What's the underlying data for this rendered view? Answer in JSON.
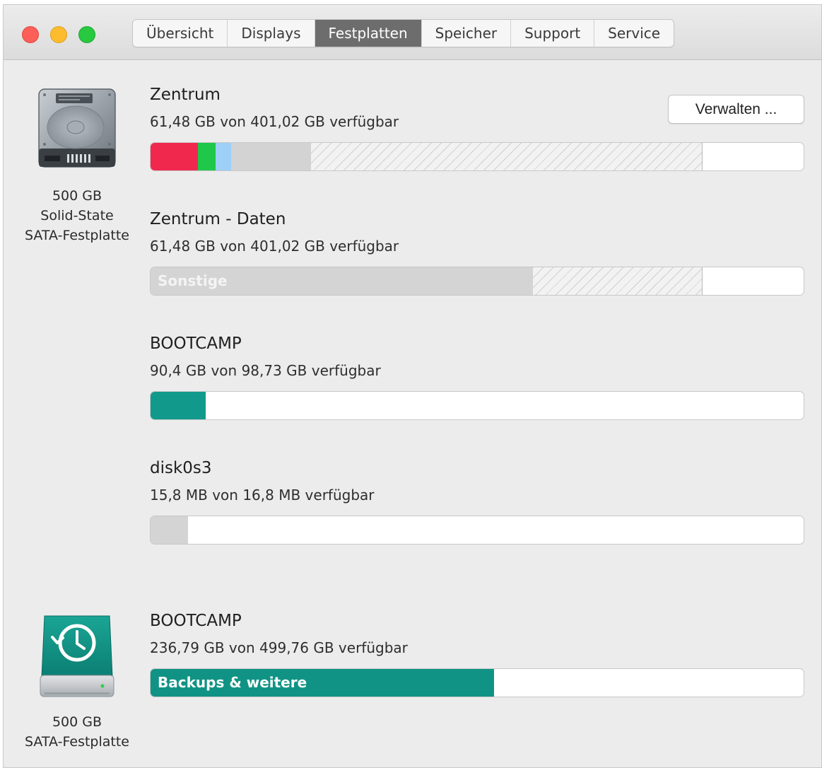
{
  "toolbar": {
    "tabs": [
      {
        "label": "Übersicht"
      },
      {
        "label": "Displays"
      },
      {
        "label": "Festplatten"
      },
      {
        "label": "Speicher"
      },
      {
        "label": "Support"
      },
      {
        "label": "Service"
      }
    ],
    "active_tab": "Festplatten"
  },
  "disks": [
    {
      "icon": "hard-drive-icon",
      "caption": [
        "500 GB",
        "Solid-State",
        "SATA-Festplatte"
      ],
      "volumes": [
        {
          "name": "Zentrum",
          "available": "61,48 GB von 401,02 GB verfügbar",
          "manage_button": "Verwalten ...",
          "usage_segments": [
            {
              "color": "#f0284e",
              "fraction": 0.073
            },
            {
              "color": "#1fc84a",
              "fraction": 0.027
            },
            {
              "color": "#9ecff6",
              "fraction": 0.024
            },
            {
              "color": "#d3d3d3",
              "fraction": 0.122
            }
          ],
          "purgeable_fraction": 0.6
        },
        {
          "name": "Zentrum - Daten",
          "available": "61,48 GB von 401,02 GB verfügbar",
          "usage_label": "Sonstige",
          "usage_segments": [
            {
              "color": "#d4d4d4",
              "fraction": 0.586
            }
          ],
          "purgeable_fraction": 0.26
        },
        {
          "name": "BOOTCAMP",
          "available": "90,4 GB von 98,73 GB verfügbar",
          "usage_segments": [
            {
              "color": "#119a8b",
              "fraction": 0.084
            }
          ]
        },
        {
          "name": "disk0s3",
          "available": "15,8 MB von 16,8 MB verfügbar",
          "usage_segments": [
            {
              "color": "#d4d4d4",
              "fraction": 0.057
            }
          ]
        }
      ]
    },
    {
      "icon": "time-machine-drive-icon",
      "caption": [
        "500 GB",
        "SATA-Festplatte"
      ],
      "volumes": [
        {
          "name": "BOOTCAMP",
          "available": "236,79 GB von 499,76 GB verfügbar",
          "usage_label": "Backups & weitere",
          "usage_segments": [
            {
              "color": "#109384",
              "fraction": 0.526
            }
          ]
        }
      ]
    }
  ]
}
